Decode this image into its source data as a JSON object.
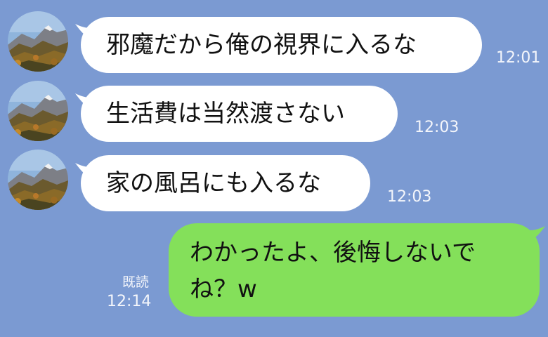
{
  "messages": [
    {
      "text": "邪魔だから俺の視界に入るな",
      "time": "12:01"
    },
    {
      "text": "生活費は当然渡さない",
      "time": "12:03"
    },
    {
      "text": "家の風呂にも入るな",
      "time": "12:03"
    }
  ],
  "reply": {
    "text": "わかったよ、後悔しないでね？w",
    "read": "既読",
    "time": "12:14"
  },
  "colors": {
    "background": "#7b9ad2",
    "incoming_bubble": "#ffffff",
    "outgoing_bubble": "#84e05a",
    "timestamp": "#f4f6fb"
  },
  "icons": {
    "avatar": "mountain-avatar-icon"
  }
}
